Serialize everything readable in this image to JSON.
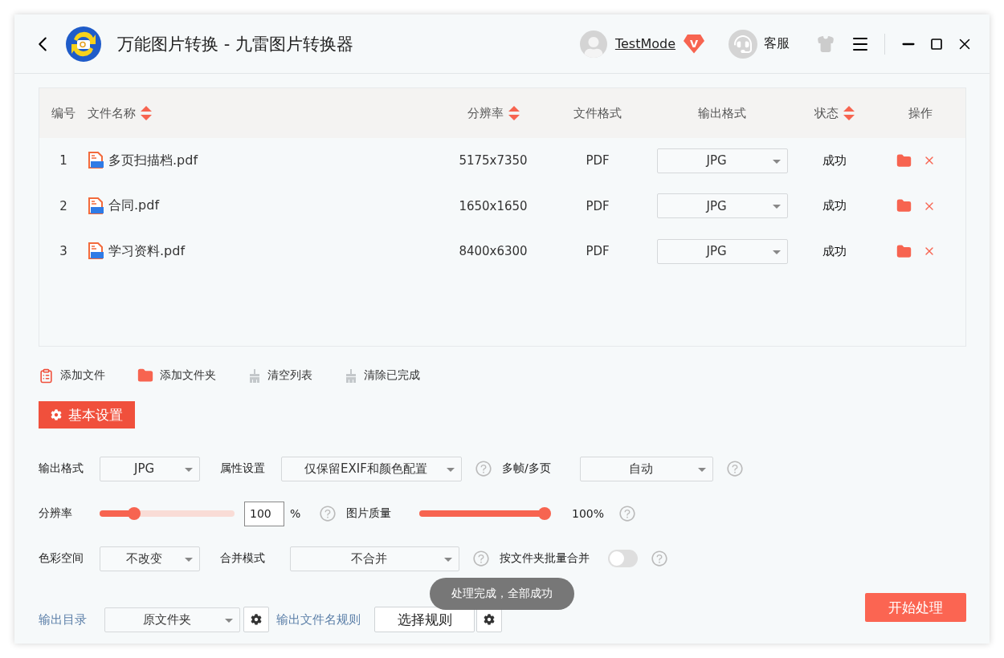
{
  "window": {
    "title": "万能图片转换 - 九雷图片转换器",
    "user": "TestMode",
    "vip_badge": "V",
    "support": "客服"
  },
  "table": {
    "columns": [
      {
        "label": "编号",
        "sortable": false
      },
      {
        "label": "文件名称",
        "sortable": true
      },
      {
        "label": "分辨率",
        "sortable": true
      },
      {
        "label": "文件格式",
        "sortable": false
      },
      {
        "label": "输出格式",
        "sortable": false
      },
      {
        "label": "状态",
        "sortable": true
      },
      {
        "label": "操作",
        "sortable": false
      }
    ],
    "rows": [
      {
        "index": "1",
        "name": "多页扫描档.pdf",
        "resolution": "5175x7350",
        "format": "PDF",
        "output_format": "JPG",
        "status": "成功"
      },
      {
        "index": "2",
        "name": "合同.pdf",
        "resolution": "1650x1650",
        "format": "PDF",
        "output_format": "JPG",
        "status": "成功"
      },
      {
        "index": "3",
        "name": "学习资料.pdf",
        "resolution": "8400x6300",
        "format": "PDF",
        "output_format": "JPG",
        "status": "成功"
      }
    ]
  },
  "toolbar": [
    {
      "label": "添加文件",
      "kind": "add-file"
    },
    {
      "label": "添加文件夹",
      "kind": "add-folder"
    },
    {
      "label": "清空列表",
      "kind": "clear"
    },
    {
      "label": "清除已完成",
      "kind": "clear"
    }
  ],
  "settings_tab": "基本设置",
  "settings": {
    "output_format": {
      "label": "输出格式",
      "value": "JPG"
    },
    "attributes": {
      "label": "属性设置",
      "value": "仅保留EXIF和颜色配置"
    },
    "multi_frame": {
      "label": "多帧/多页",
      "value": "自动"
    },
    "resolution": {
      "label": "分辨率",
      "level": 0.23,
      "value": "100",
      "unit": "%"
    },
    "quality": {
      "label": "图片质量",
      "level": 1,
      "reading": "100%"
    },
    "color_space": {
      "label": "色彩空间",
      "value": "不改变"
    },
    "merge_mode": {
      "label": "合并模式",
      "value": "不合并"
    },
    "folder_merge": {
      "label": "按文件夹批量合并",
      "on": false
    }
  },
  "footer": {
    "output_dir_label": "输出目录",
    "output_dir": "原文件夹",
    "rule_label": "输出文件名规则",
    "rule_button": "选择规则",
    "start_button": "开始处理"
  },
  "toast": "处理完成，全部成功"
}
